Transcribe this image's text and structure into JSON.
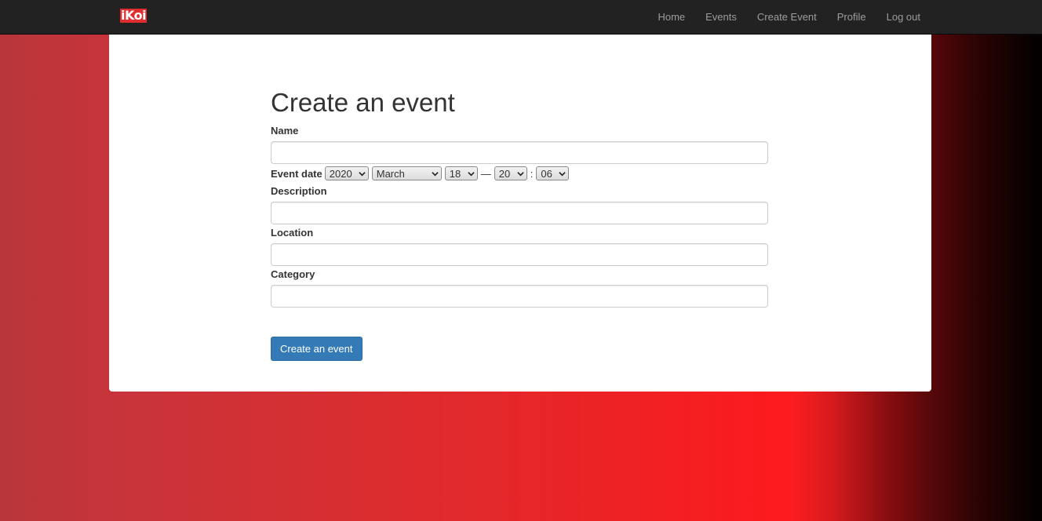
{
  "brand": "iKoi",
  "nav": [
    {
      "label": "Home"
    },
    {
      "label": "Events"
    },
    {
      "label": "Create Event"
    },
    {
      "label": "Profile"
    },
    {
      "label": "Log out"
    }
  ],
  "form": {
    "title": "Create an event",
    "name_label": "Name",
    "name_value": "",
    "event_date_label": "Event date",
    "date": {
      "year": "2020",
      "month": "March",
      "day": "18",
      "time_separator": "—",
      "hour": "20",
      "colon": ":",
      "minute": "06"
    },
    "description_label": "Description",
    "description_value": "",
    "location_label": "Location",
    "location_value": "",
    "category_label": "Category",
    "category_value": "",
    "submit_label": "Create an event"
  },
  "colors": {
    "navbar": "#222222",
    "primary_button": "#337ab7",
    "brand_logo": "#e02d2f"
  }
}
